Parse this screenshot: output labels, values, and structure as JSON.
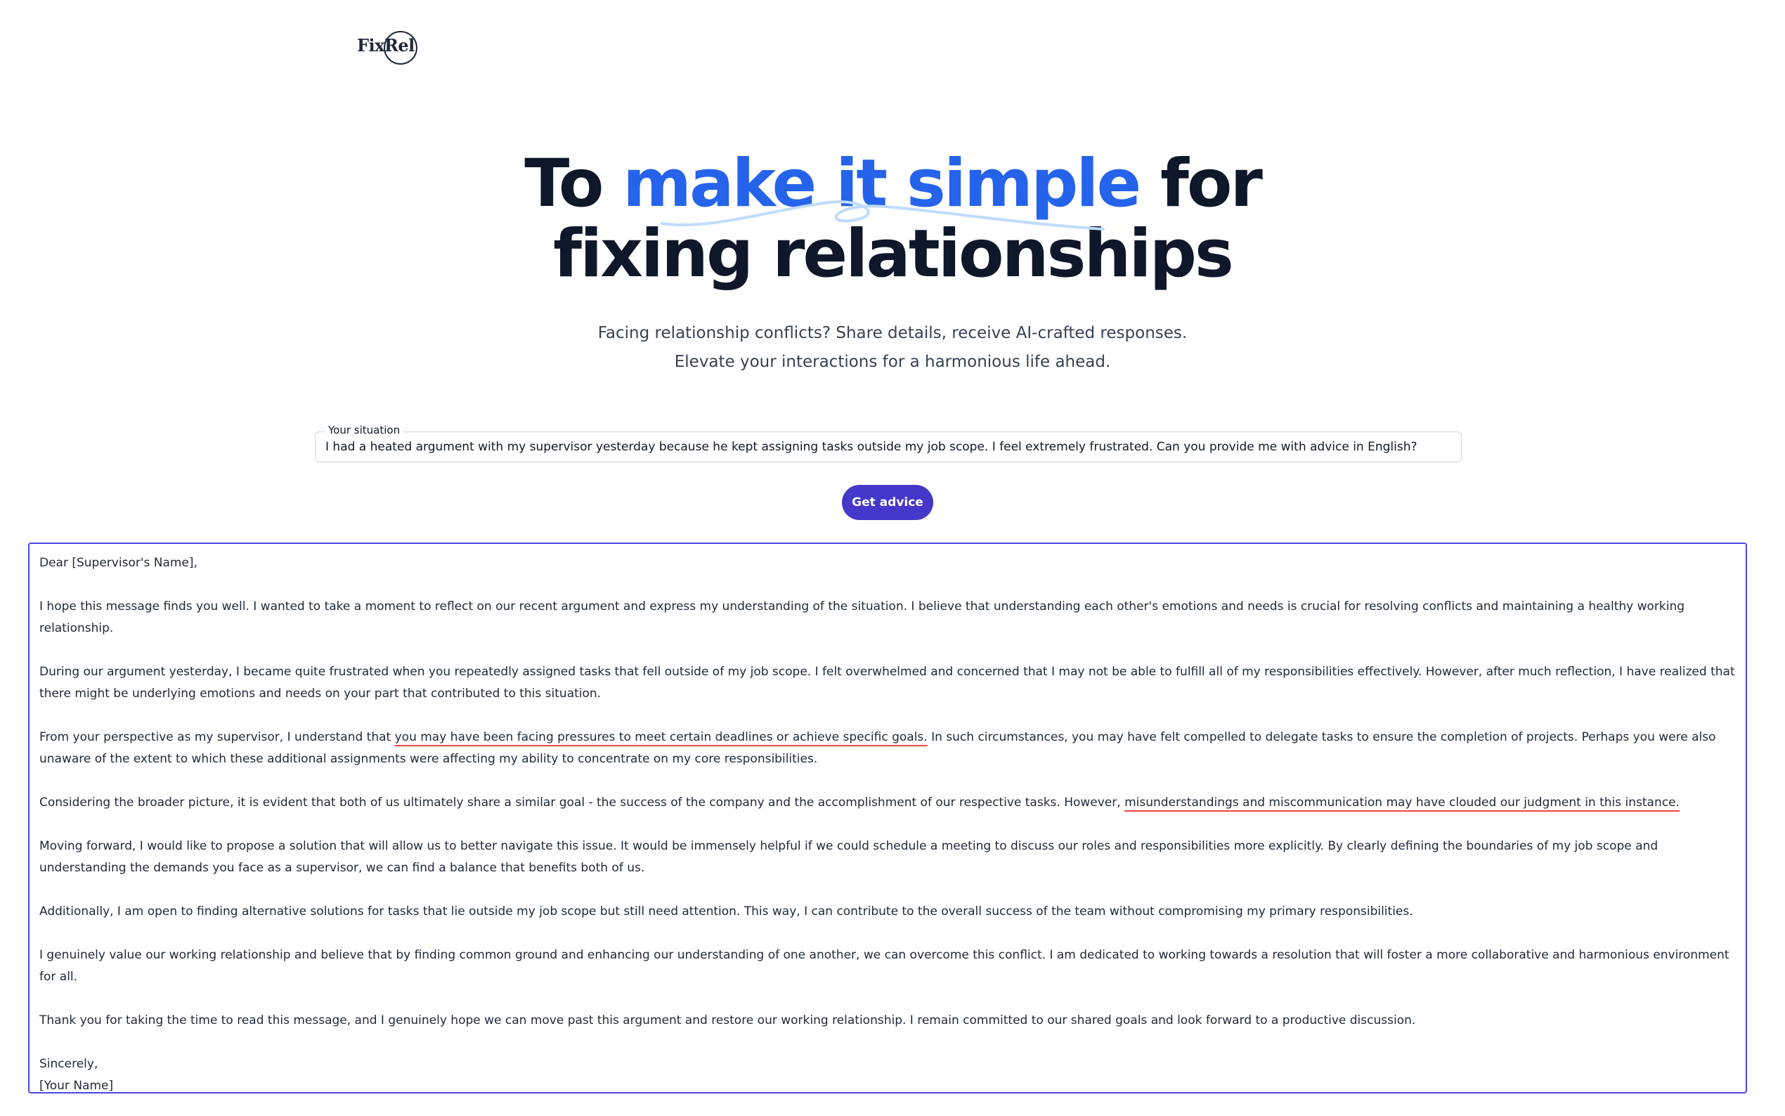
{
  "brand": {
    "logo_text": "FixRel"
  },
  "hero": {
    "line1_pre": "To ",
    "line1_accent": "make it simple",
    "line1_post": " for",
    "line2": "fixing relationships"
  },
  "subtitle": {
    "line1": "Facing relationship conflicts? Share details, receive AI-crafted responses.",
    "line2": "Elevate your interactions for a harmonious life ahead."
  },
  "situation": {
    "label": "Your situation",
    "value": "I had a heated argument with my supervisor yesterday because he kept assigning tasks outside my job scope. I feel extremely frustrated. Can you provide me with advice in English?"
  },
  "action": {
    "button_label": "Get advice"
  },
  "response": {
    "greeting": "Dear [Supervisor's Name],",
    "p1": "I hope this message finds you well. I wanted to take a moment to reflect on our recent argument and express my understanding of the situation. I believe that understanding each other's emotions and needs is crucial for resolving conflicts and maintaining a healthy working relationship.",
    "p2": "During our argument yesterday, I became quite frustrated when you repeatedly assigned tasks that fell outside of my job scope. I felt overwhelmed and concerned that I may not be able to fulfill all of my responsibilities effectively. However, after much reflection, I have realized that there might be underlying emotions and needs on your part that contributed to this situation.",
    "p3_pre": "From your perspective as my supervisor, I understand that ",
    "p3_highlight": "you may have been facing pressures to meet certain deadlines or achieve specific goals.",
    "p3_post": " In such circumstances, you may have felt compelled to delegate tasks to ensure the completion of projects. Perhaps you were also unaware of the extent to which these additional assignments were affecting my ability to concentrate on my core responsibilities.",
    "p4_pre": "Considering the broader picture, it is evident that both of us ultimately share a similar goal - the success of the company and the accomplishment of our respective tasks. However, ",
    "p4_highlight": "misunderstandings and miscommunication may have clouded our judgment in this instance.",
    "p5": "Moving forward, I would like to propose a solution that will allow us to better navigate this issue. It would be immensely helpful if we could schedule a meeting to discuss our roles and responsibilities more explicitly. By clearly defining the boundaries of my job scope and understanding the demands you face as a supervisor, we can find a balance that benefits both of us.",
    "p6": "Additionally, I am open to finding alternative solutions for tasks that lie outside my job scope but still need attention. This way, I can contribute to the overall success of the team without compromising my primary responsibilities.",
    "p7": "I genuinely value our working relationship and believe that by finding common ground and enhancing our understanding of one another, we can overcome this conflict. I am dedicated to working towards a resolution that will foster a more collaborative and harmonious environment for all.",
    "p8": "Thank you for taking the time to read this message, and I genuinely hope we can move past this argument and restore our working relationship. I remain committed to our shared goals and look forward to a productive discussion.",
    "closing": "Sincerely,",
    "signature": "[Your Name]"
  },
  "colors": {
    "accent_blue": "#2563eb",
    "button": "#4338ca",
    "result_border": "#4f46e5",
    "annotation_red": "#ef4444"
  }
}
